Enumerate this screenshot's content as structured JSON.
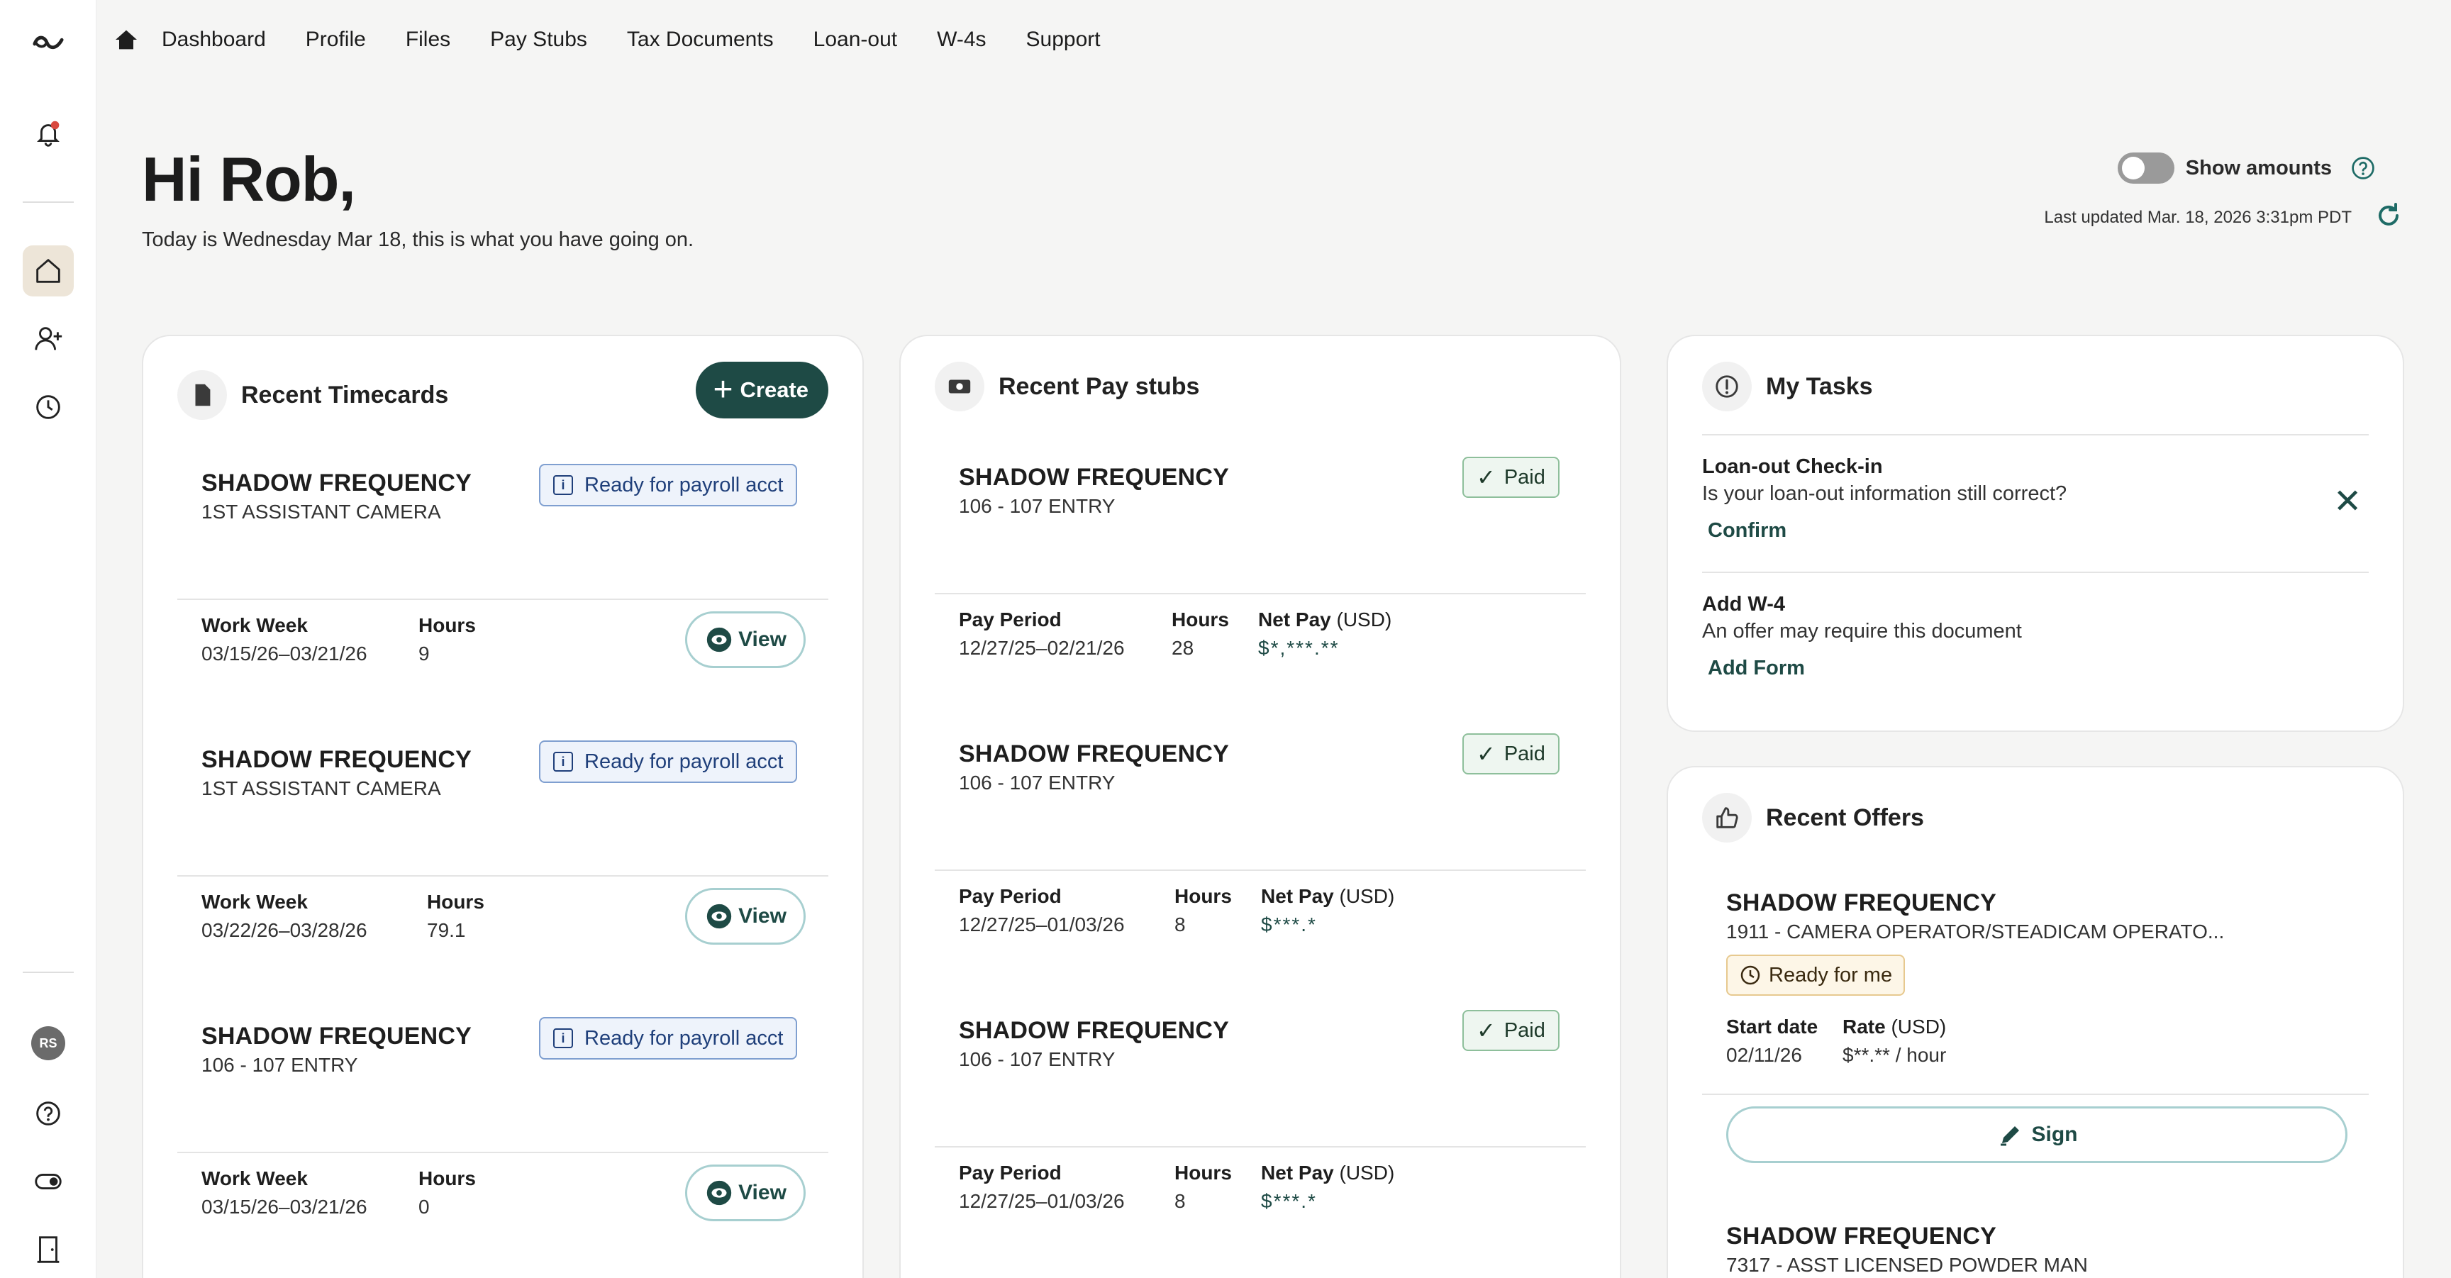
{
  "nav": {
    "items": [
      {
        "label": "Dashboard"
      },
      {
        "label": "Profile"
      },
      {
        "label": "Files"
      },
      {
        "label": "Pay Stubs"
      },
      {
        "label": "Tax Documents"
      },
      {
        "label": "Loan-out"
      },
      {
        "label": "W-4s"
      },
      {
        "label": "Support"
      }
    ]
  },
  "sidebar": {
    "avatar_initials": "RS"
  },
  "header": {
    "greeting": "Hi Rob,",
    "subtitle": "Today is Wednesday Mar 18, this is what you have going on.",
    "toggle_label": "Show amounts",
    "last_updated": "Last updated Mar. 18, 2026 3:31pm PDT"
  },
  "timecards": {
    "title": "Recent Timecards",
    "create_label": "Create",
    "items": [
      {
        "production": "SHADOW FREQUENCY",
        "role": "1ST ASSISTANT CAMERA",
        "status": "Ready for payroll acct",
        "week_label": "Work Week",
        "week": "03/15/26–03/21/26",
        "hours_label": "Hours",
        "hours": "9",
        "view_label": "View"
      },
      {
        "production": "SHADOW FREQUENCY",
        "role": "1ST ASSISTANT CAMERA",
        "status": "Ready for payroll acct",
        "week_label": "Work Week",
        "week": "03/22/26–03/28/26",
        "hours_label": "Hours",
        "hours": "79.1",
        "view_label": "View"
      },
      {
        "production": "SHADOW FREQUENCY",
        "role": "106 - 107 ENTRY",
        "status": "Ready for payroll acct",
        "week_label": "Work Week",
        "week": "03/15/26–03/21/26",
        "hours_label": "Hours",
        "hours": "0",
        "view_label": "View"
      }
    ]
  },
  "paystubs": {
    "title": "Recent Pay stubs",
    "items": [
      {
        "production": "SHADOW FREQUENCY",
        "role": "106 - 107 ENTRY",
        "status": "Paid",
        "period_label": "Pay Period",
        "period": "12/27/25–02/21/26",
        "hours_label": "Hours",
        "hours": "28",
        "net_label": "Net Pay",
        "net_unit": "(USD)",
        "net": "$*,***.**"
      },
      {
        "production": "SHADOW FREQUENCY",
        "role": "106 - 107 ENTRY",
        "status": "Paid",
        "period_label": "Pay Period",
        "period": "12/27/25–01/03/26",
        "hours_label": "Hours",
        "hours": "8",
        "net_label": "Net Pay",
        "net_unit": "(USD)",
        "net": "$***.*"
      },
      {
        "production": "SHADOW FREQUENCY",
        "role": "106 - 107 ENTRY",
        "status": "Paid",
        "period_label": "Pay Period",
        "period": "12/27/25–01/03/26",
        "hours_label": "Hours",
        "hours": "8",
        "net_label": "Net Pay",
        "net_unit": "(USD)",
        "net": "$***.*"
      }
    ]
  },
  "tasks": {
    "title": "My Tasks",
    "items": [
      {
        "title": "Loan-out Check-in",
        "desc": "Is your loan-out information still correct?",
        "action": "Confirm"
      },
      {
        "title": "Add W-4",
        "desc": "An offer may require this document",
        "action": "Add Form"
      }
    ]
  },
  "offers": {
    "title": "Recent Offers",
    "items": [
      {
        "production": "SHADOW FREQUENCY",
        "role": "1911 - CAMERA OPERATOR/STEADICAM OPERATO...",
        "status": "Ready for me",
        "start_label": "Start date",
        "start": "02/11/26",
        "rate_label": "Rate",
        "rate_unit": "(USD)",
        "rate": "$**.** / hour",
        "sign_label": "Sign"
      },
      {
        "production": "SHADOW FREQUENCY",
        "role": "7317 - ASST LICENSED POWDER MAN"
      }
    ]
  }
}
